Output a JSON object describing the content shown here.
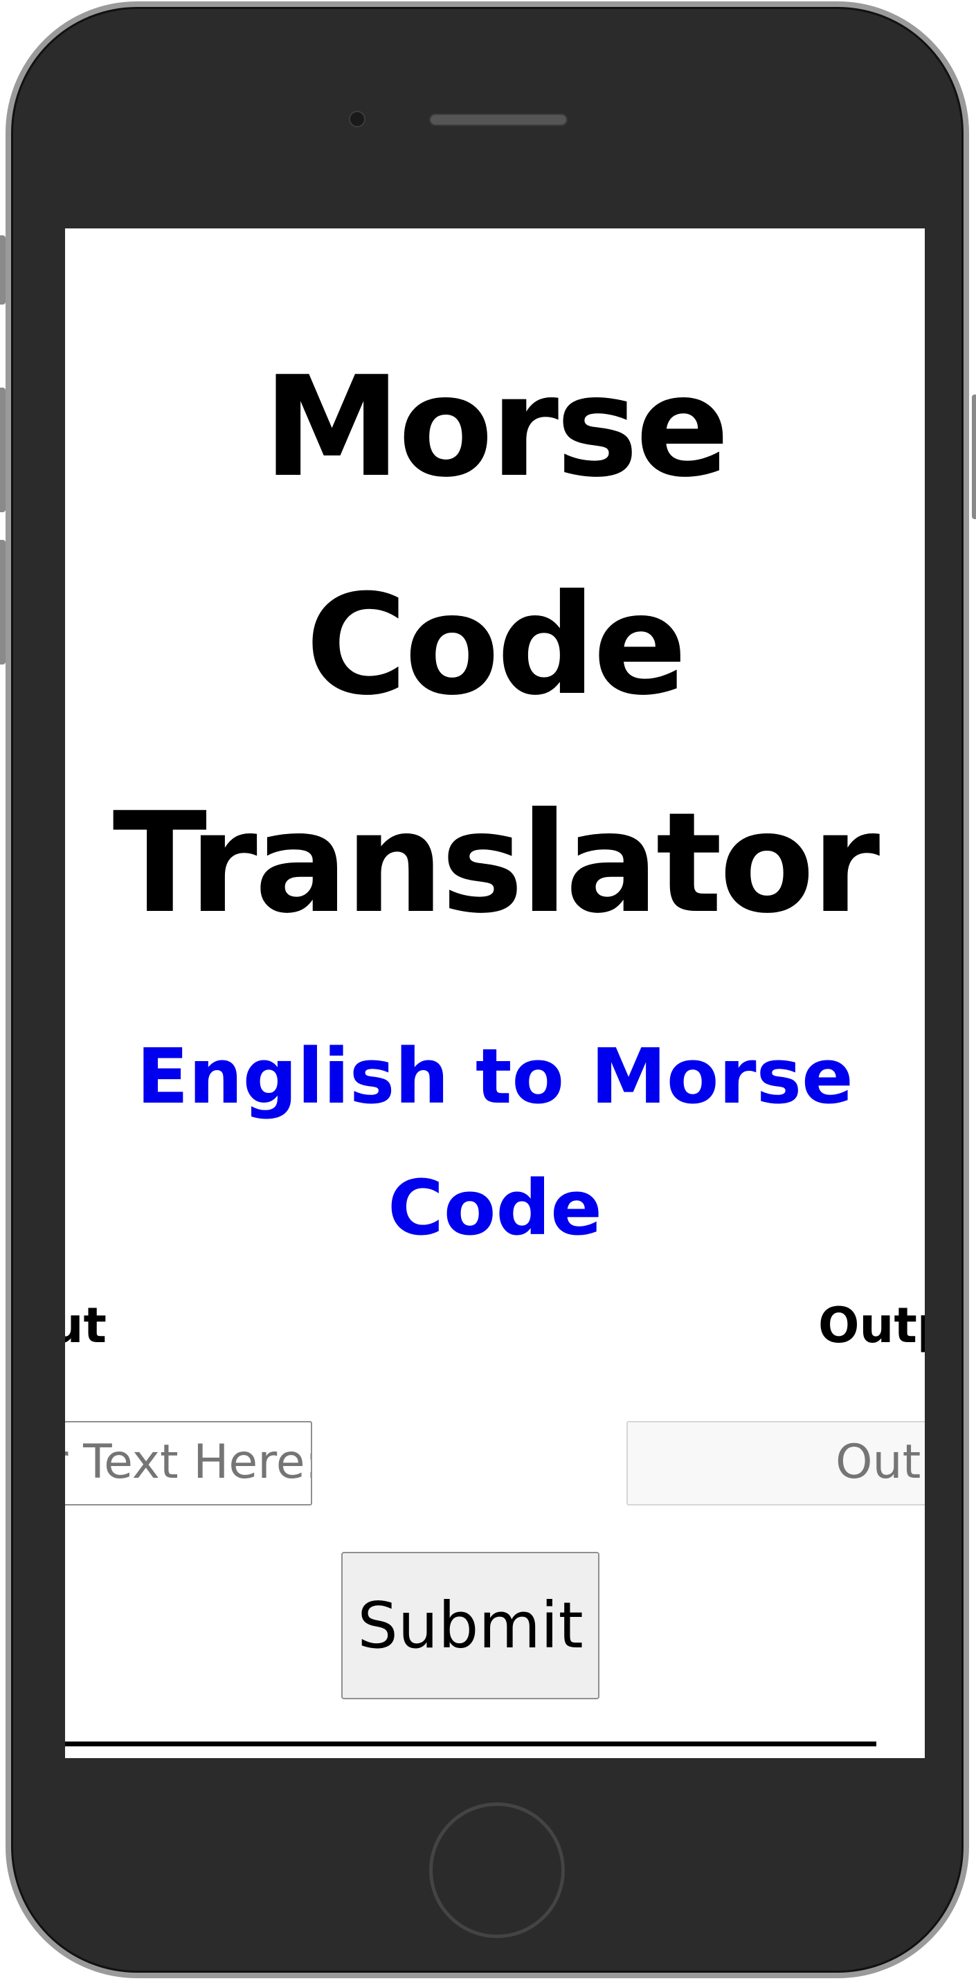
{
  "app": {
    "title_lines": [
      "Morse",
      "Code",
      "Translator"
    ],
    "subtitle": "English to Morse Code"
  },
  "form": {
    "input_label": "Input",
    "output_label": "Output",
    "input_placeholder": "Enter Text Here:",
    "output_placeholder": "Output",
    "submit_label": "Submit"
  },
  "colors": {
    "subtitle": "#0000ee",
    "phone_body": "#2b2b2b",
    "screen_bg": "#ffffff"
  }
}
